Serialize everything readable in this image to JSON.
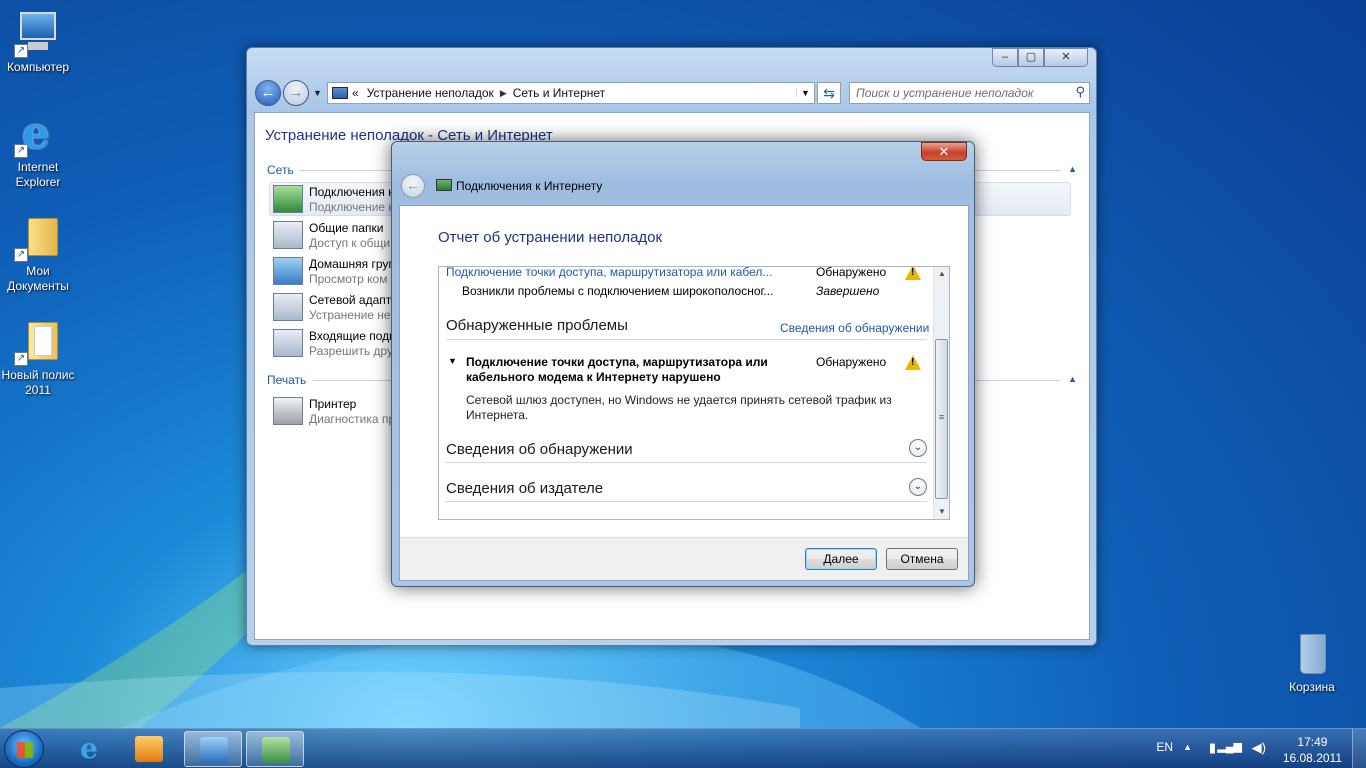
{
  "desktop": {
    "icons": [
      {
        "label": "Компьютер"
      },
      {
        "label": "Internet Explorer"
      },
      {
        "label": "Мои Документы"
      },
      {
        "label": "Новый полис 2011"
      },
      {
        "label": "Корзина"
      }
    ]
  },
  "explorer": {
    "controls": {
      "minimize": "–",
      "maximize": "▢",
      "close": "✕"
    },
    "address": {
      "prefix": "«",
      "crumbs": [
        "Устранение неполадок",
        "Сеть и Интернет"
      ]
    },
    "search_placeholder": "Поиск и устранение неполадок",
    "title": "Устранение неполадок - Сеть и Интернет",
    "sections": [
      {
        "name": "Сеть"
      },
      {
        "name": "Печать"
      }
    ],
    "items": [
      {
        "title": "Подключения к",
        "desc": "Подключение к"
      },
      {
        "title": "Общие папки",
        "desc": "Доступ к общи"
      },
      {
        "title": "Домашняя груп",
        "desc": "Просмотр ком"
      },
      {
        "title": "Сетевой адапте",
        "desc": "Устранение неп"
      },
      {
        "title": "Входящие подк",
        "desc": "Разрешить дру"
      },
      {
        "title": "Принтер",
        "desc": "Диагностика пр"
      }
    ]
  },
  "dialog": {
    "close_label": "✕",
    "title": "Подключения к Интернету",
    "heading": "Отчет об устранении неполадок",
    "report": {
      "row1": {
        "text": "Подключение точки доступа, маршрутизатора или кабел...",
        "status": "Обнаружено"
      },
      "row2": {
        "text": "Возникли проблемы с подключением широкополосног...",
        "status": "Завершено"
      },
      "found_title": "Обнаруженные проблемы",
      "found_link": "Сведения об обнаружении",
      "problem": {
        "title_line1": "Подключение точки доступа, маршрутизатора или",
        "title_line2": "кабельного модема к Интернету нарушено",
        "status": "Обнаружено",
        "desc_line1": "Сетевой шлюз доступен, но Windows не удается принять сетевой трафик из",
        "desc_line2": "Интернета."
      },
      "detection_details": "Сведения об обнаружении",
      "publisher_details": "Сведения об издателе"
    },
    "buttons": {
      "next": "Далее",
      "cancel": "Отмена"
    }
  },
  "taskbar": {
    "lang": "EN",
    "time": "17:49",
    "date": "16.08.2011"
  },
  "colors": {
    "accent": "#1e3287",
    "link": "#1e5aa8",
    "warning": "#e8b800"
  }
}
